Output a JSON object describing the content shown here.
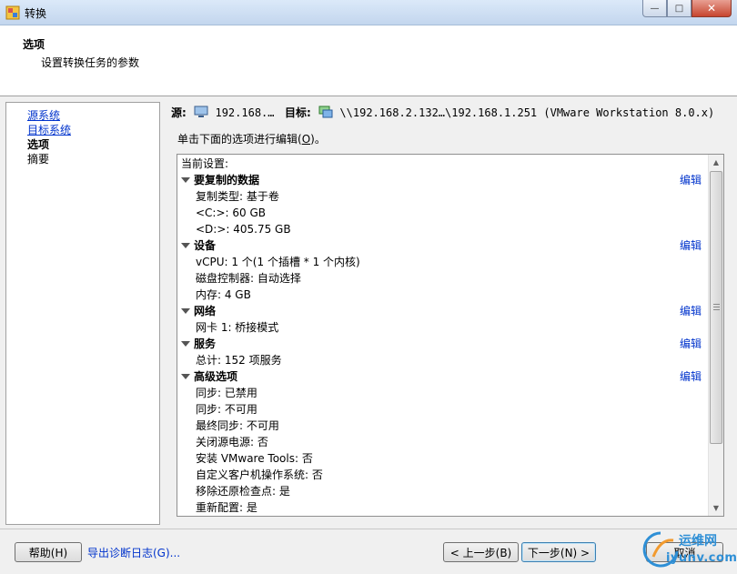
{
  "window": {
    "title": "转换",
    "minimize": "—",
    "maximize": "□",
    "close": "✕"
  },
  "header": {
    "title": "选项",
    "subtitle": "设置转换任务的参数"
  },
  "nav": {
    "items": [
      {
        "label": "源系统",
        "state": "link"
      },
      {
        "label": "目标系统",
        "state": "link"
      },
      {
        "label": "选项",
        "state": "current"
      },
      {
        "label": "摘要",
        "state": "plain"
      }
    ]
  },
  "source_target": {
    "source_label": "源:",
    "source_value": "192.168.…",
    "target_label": "目标:",
    "target_value": "\\\\192.168.2.132…\\192.168.1.251 (VMware Workstation 8.0.x)"
  },
  "instruction": {
    "text_before": "单击下面的选项进行编辑(",
    "hotkey": "O",
    "text_after": ")。"
  },
  "settings": {
    "current_label": "当前设置:",
    "edit_label": "编辑",
    "sections": [
      {
        "title": "要复制的数据",
        "items": [
          "复制类型: 基于卷",
          "<C:>: 60 GB",
          "<D:>: 405.75 GB"
        ]
      },
      {
        "title": "设备",
        "items": [
          "vCPU: 1 个(1 个插槽 * 1 个内核)",
          "磁盘控制器: 自动选择",
          "内存: 4 GB"
        ]
      },
      {
        "title": "网络",
        "items": [
          "网卡 1: 桥接模式"
        ]
      },
      {
        "title": "服务",
        "items": [
          "总计: 152 项服务"
        ]
      },
      {
        "title": "高级选项",
        "items": [
          "同步: 已禁用",
          "同步: 不可用",
          "最终同步: 不可用",
          "关闭源电源: 否",
          "安装 VMware Tools: 否",
          "自定义客户机操作系统: 否",
          "移除还原检查点: 是",
          "重新配置: 是"
        ]
      }
    ]
  },
  "footer": {
    "help_button": "帮助(H)",
    "diagnostics_link": "导出诊断日志(G)...",
    "back_button": "< 上一步(B)",
    "next_button": "下一步(N) >",
    "cancel_button": "取消"
  },
  "watermark": {
    "line1": "运维网",
    "line2": "iyunv.com"
  }
}
